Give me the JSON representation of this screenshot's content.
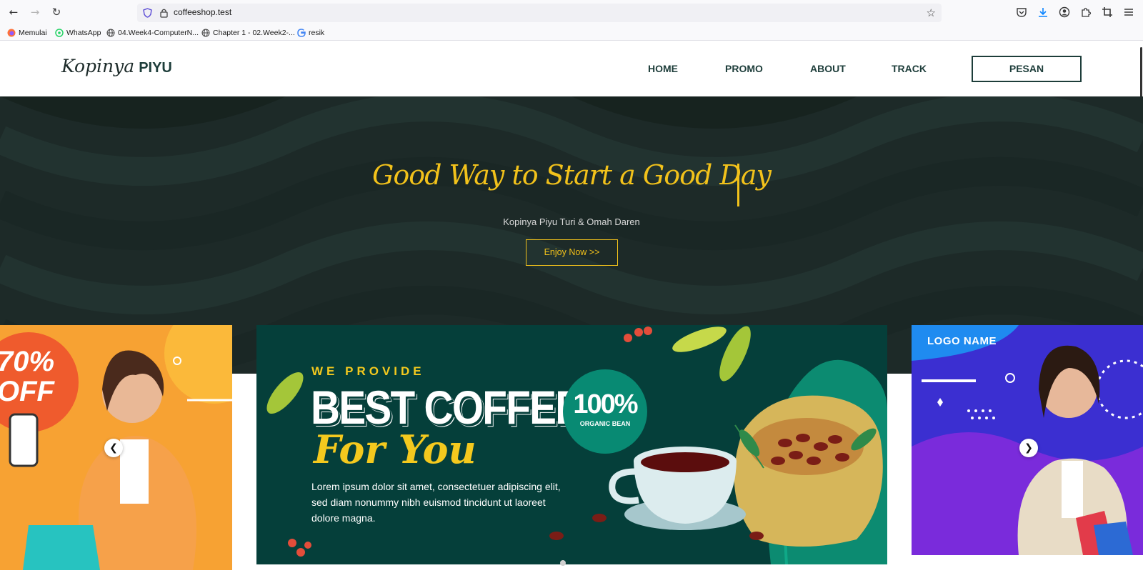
{
  "browser": {
    "url": "coffeeshop.test",
    "bookmarks": [
      {
        "label": "Memulai",
        "icon": "firefox-icon"
      },
      {
        "label": "WhatsApp",
        "icon": "whatsapp-icon"
      },
      {
        "label": "04.Week4-ComputerN...",
        "icon": "globe-icon"
      },
      {
        "label": "Chapter 1 - 02.Week2-...",
        "icon": "globe-icon"
      },
      {
        "label": "resik",
        "icon": "google-icon"
      }
    ]
  },
  "site": {
    "logo_script": "Kopinya",
    "logo_bold": "PIYU",
    "menu": [
      "HOME",
      "PROMO",
      "ABOUT",
      "TRACK"
    ],
    "cta": "PESAN"
  },
  "hero": {
    "title": "Good Way to Start a Good Day",
    "subtitle": "Kopinya Piyu Turi & Omah Daren",
    "button": "Enjoy Now >>"
  },
  "slides": {
    "left": {
      "promo": "70%\nOFF"
    },
    "main": {
      "kicker": "WE PROVIDE",
      "headline": "BEST COFFEE",
      "script": "For You",
      "body": "Lorem ipsum dolor sit amet, consectetuer adipiscing elit, sed diam nonummy nibh euismod tincidunt ut laoreet dolore magna.",
      "badge_value": "100%",
      "badge_label": "ORGANIC BEAN"
    },
    "right": {
      "brand": "LOGO NAME"
    }
  },
  "colors": {
    "accent_gold": "#f2c21b",
    "dark_green": "#1d3d3a",
    "hero_bg": "#1d2a28"
  }
}
